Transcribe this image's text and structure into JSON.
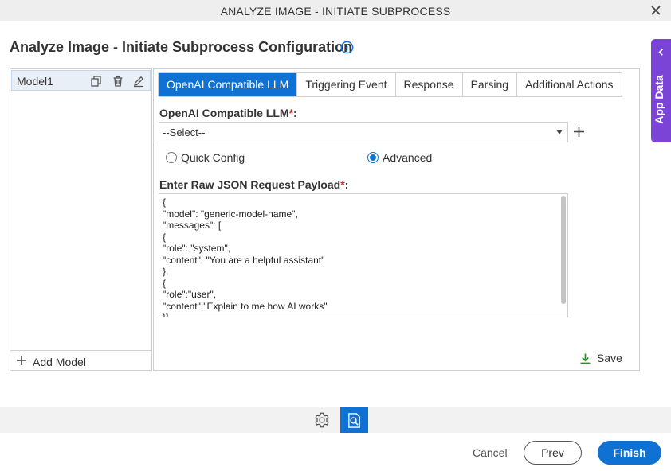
{
  "window": {
    "title": "ANALYZE IMAGE - INITIATE SUBPROCESS",
    "close_icon": "close-icon"
  },
  "page": {
    "title": "Analyze Image - Initiate Subprocess Configuration",
    "info_icon": "info-icon"
  },
  "app_data_tab": {
    "label": "App Data",
    "color": "#7b44d6"
  },
  "models": {
    "items": [
      {
        "name": "Model1"
      }
    ],
    "add_label": "Add Model"
  },
  "tabs": [
    {
      "label": "OpenAI Compatible LLM",
      "active": true
    },
    {
      "label": "Triggering Event",
      "active": false
    },
    {
      "label": "Response",
      "active": false
    },
    {
      "label": "Parsing",
      "active": false
    },
    {
      "label": "Additional Actions",
      "active": false
    }
  ],
  "form": {
    "llm_label": "OpenAI Compatible LLM",
    "llm_required": "*",
    "llm_suffix": ":",
    "llm_value": "--Select--",
    "radio_quick": "Quick Config",
    "radio_advanced": "Advanced",
    "selected_mode": "Advanced",
    "payload_label": "Enter Raw JSON Request Payload",
    "payload_required": "*",
    "payload_suffix": ":",
    "payload_value": "{\n\"model\": \"generic-model-name\",\n\"messages\": [\n{\n\"role\": \"system\",\n\"content\": \"You are a helpful assistant\"\n},\n{\n\"role\":\"user\",\n\"content\":\"Explain to me how AI works\"\n}]",
    "save_label": "Save"
  },
  "footer": {
    "cancel_label": "Cancel",
    "prev_label": "Prev",
    "finish_label": "Finish"
  },
  "colors": {
    "accent": "#0f72d3",
    "required": "#d9262e",
    "save_icon": "#2e8b2e"
  }
}
